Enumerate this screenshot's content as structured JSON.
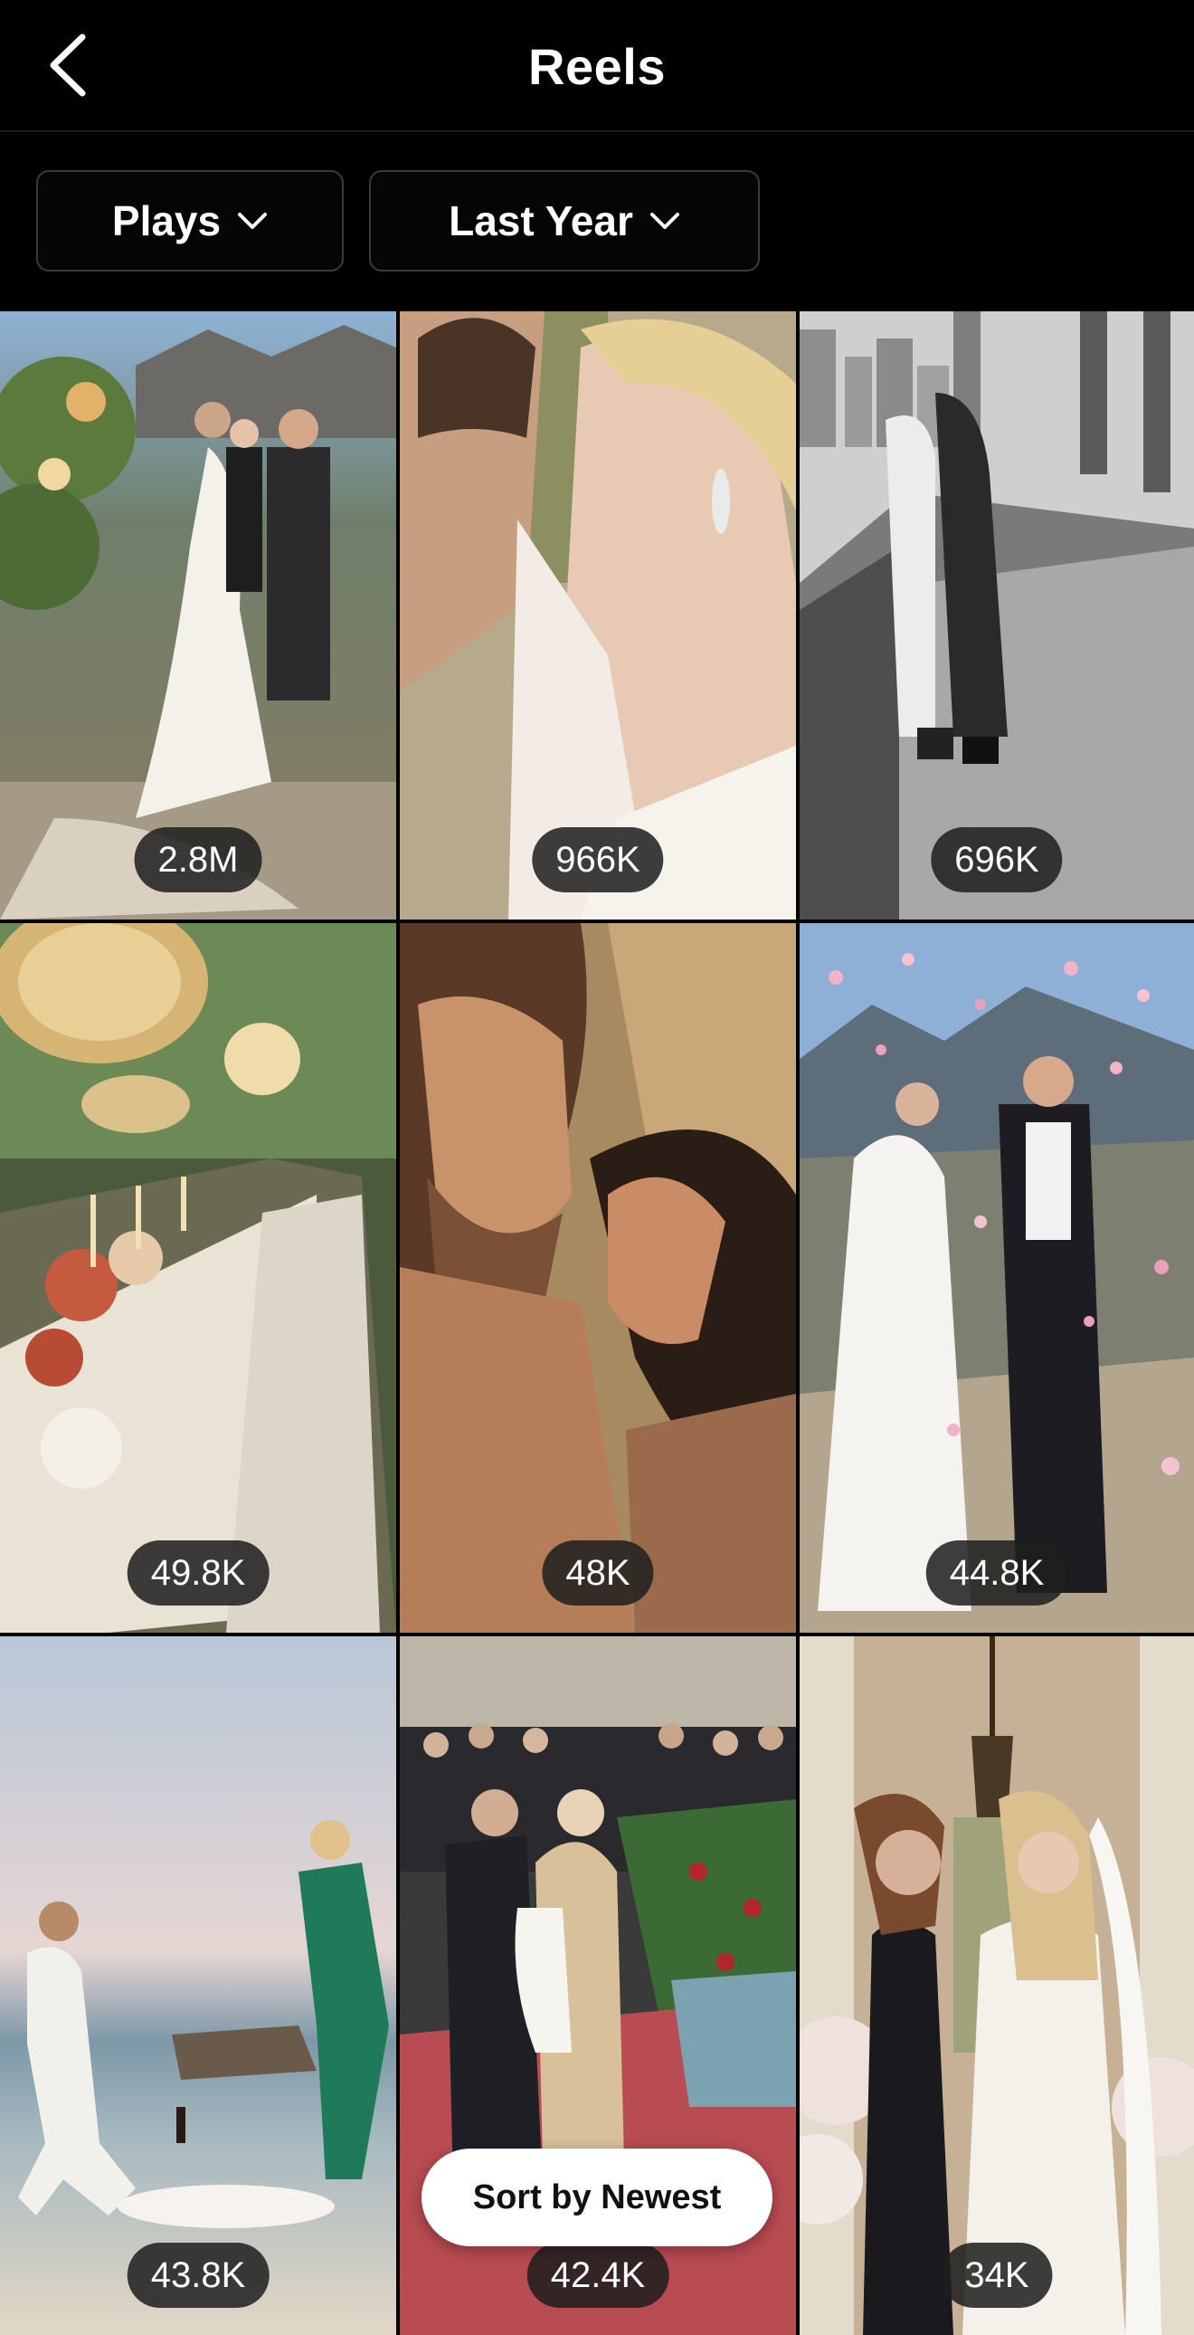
{
  "header": {
    "title": "Reels",
    "back_icon": "chevron-left-icon"
  },
  "filters": {
    "metric": {
      "label": "Plays",
      "icon": "chevron-down-icon"
    },
    "range": {
      "label": "Last Year",
      "icon": "chevron-down-icon"
    }
  },
  "reels": [
    {
      "plays": "2.8M"
    },
    {
      "plays": "966K"
    },
    {
      "plays": "696K"
    },
    {
      "plays": "49.8K"
    },
    {
      "plays": "48K"
    },
    {
      "plays": "44.8K"
    },
    {
      "plays": "43.8K"
    },
    {
      "plays": "42.4K"
    },
    {
      "plays": "34K"
    }
  ],
  "sort_button": {
    "label": "Sort by Newest"
  },
  "colors": {
    "background": "#000000",
    "pill_background": "#1e1e1e",
    "sort_pill_background": "#ffffff"
  }
}
